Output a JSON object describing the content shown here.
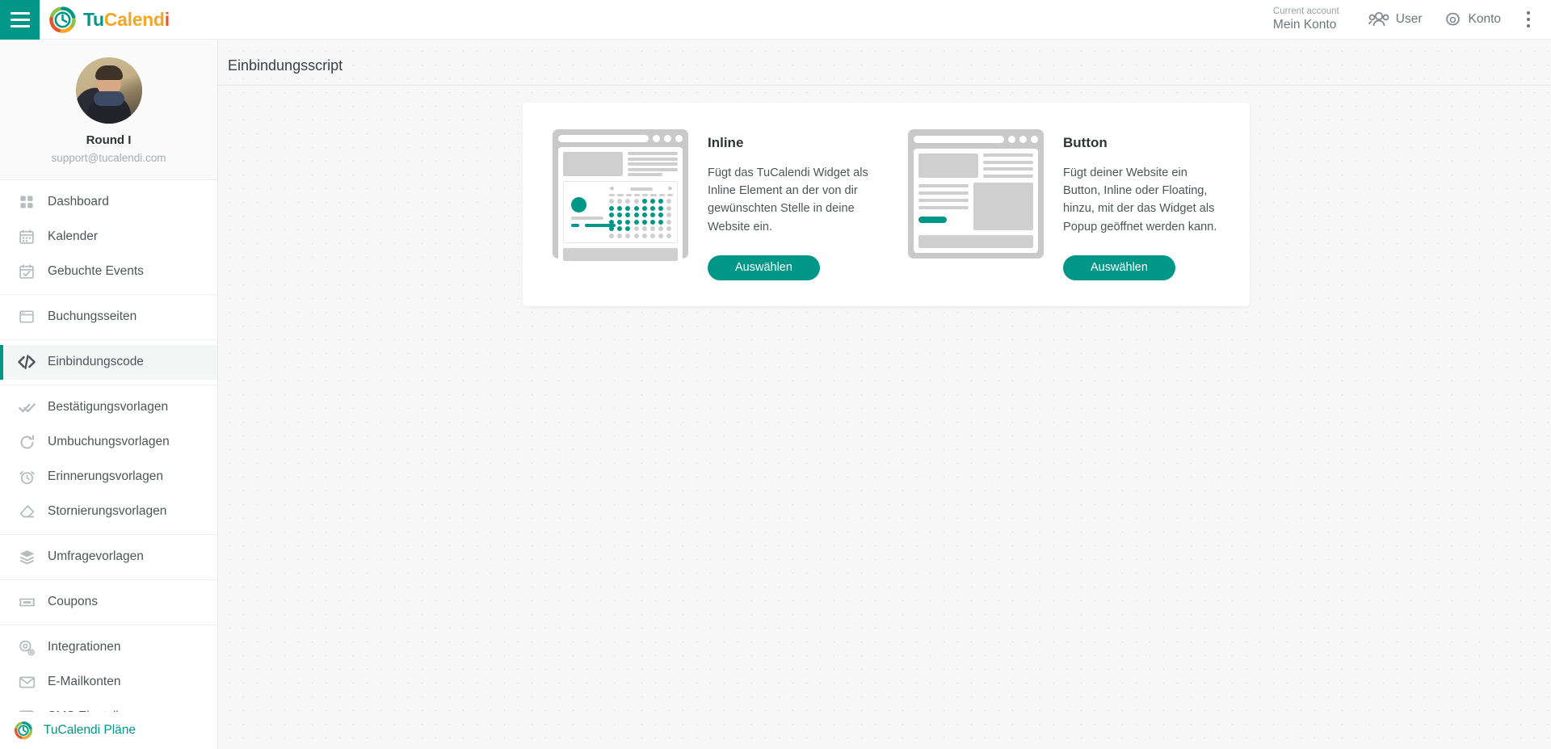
{
  "topbar": {
    "menu_icon": "hamburger-icon",
    "brand": {
      "part1": "Tu",
      "part2": "Calend",
      "part3": "i",
      "logo_icon": "tucalendi-logo-icon"
    },
    "account": {
      "label": "Current account",
      "value": "Mein Konto"
    },
    "user": {
      "label": "User",
      "icon": "users-icon"
    },
    "settings": {
      "label": "Konto",
      "icon": "gear-icon"
    },
    "more_icon": "kebab-menu-icon"
  },
  "sidebar": {
    "profile": {
      "name": "Round I",
      "email": "support@tucalendi.com",
      "avatar": "user-avatar"
    },
    "groups": [
      {
        "items": [
          {
            "label": "Dashboard",
            "icon": "dashboard-icon",
            "active": false
          },
          {
            "label": "Kalender",
            "icon": "calendar-icon",
            "active": false
          },
          {
            "label": "Gebuchte Events",
            "icon": "calendar-check-icon",
            "active": false
          }
        ]
      },
      {
        "items": [
          {
            "label": "Buchungsseiten",
            "icon": "browser-window-icon",
            "active": false
          }
        ]
      },
      {
        "items": [
          {
            "label": "Einbindungscode",
            "icon": "code-icon",
            "active": true
          }
        ]
      },
      {
        "items": [
          {
            "label": "Bestätigungsvorlagen",
            "icon": "double-check-icon",
            "active": false
          },
          {
            "label": "Umbuchungsvorlagen",
            "icon": "refresh-icon",
            "active": false
          },
          {
            "label": "Erinnerungsvorlagen",
            "icon": "alarm-clock-icon",
            "active": false
          },
          {
            "label": "Stornierungsvorlagen",
            "icon": "eraser-icon",
            "active": false
          }
        ]
      },
      {
        "items": [
          {
            "label": "Umfragevorlagen",
            "icon": "layers-icon",
            "active": false
          }
        ]
      },
      {
        "items": [
          {
            "label": "Coupons",
            "icon": "ticket-icon",
            "active": false
          }
        ]
      },
      {
        "items": [
          {
            "label": "Integrationen",
            "icon": "gears-icon",
            "active": false
          },
          {
            "label": "E-Mailkonten",
            "icon": "envelope-icon",
            "active": false
          },
          {
            "label": "SMS Einstellungen",
            "icon": "sms-icon",
            "active": false
          }
        ]
      }
    ],
    "plans": {
      "label": "TuCalendi Pläne",
      "icon": "tucalendi-logo-icon"
    }
  },
  "main": {
    "page_title": "Einbindungsscript",
    "options": [
      {
        "title": "Inline",
        "description": "Fügt das TuCalendi Widget als Inline Element an der von dir gewünschten Stelle in deine Website ein.",
        "button": "Auswählen",
        "illustration": "inline-widget-preview"
      },
      {
        "title": "Button",
        "description": "Fügt deiner Website ein Button, Inline oder Floating, hinzu, mit der das Widget als Popup geöffnet werden kann.",
        "button": "Auswählen",
        "illustration": "button-widget-preview"
      }
    ]
  },
  "colors": {
    "accent": "#009688",
    "logo_orange": "#f5a623",
    "logo_green": "#8bc34a",
    "logo_red": "#e8552d",
    "sidebar_bg": "#ffffff",
    "main_bg": "#f7f7f7"
  }
}
